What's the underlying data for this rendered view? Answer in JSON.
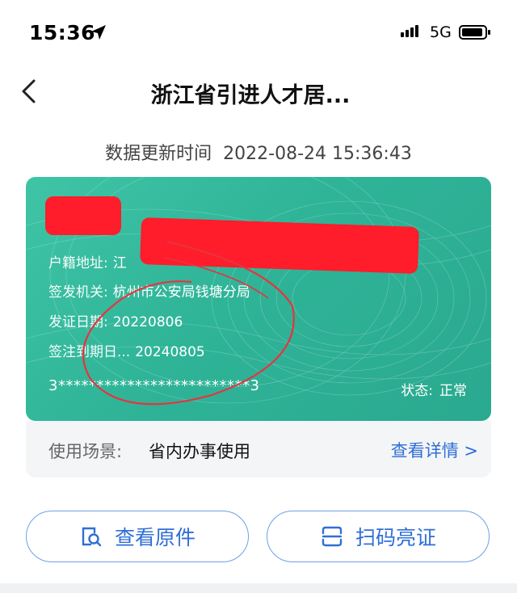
{
  "status_bar": {
    "time": "15:36",
    "network": "5G"
  },
  "nav": {
    "title": "浙江省引进人才居..."
  },
  "update": {
    "label": "数据更新时间",
    "value": "2022-08-24 15:36:43"
  },
  "card": {
    "fields": [
      {
        "label": "户籍地址:",
        "value": "江"
      },
      {
        "label": "签发机关:",
        "value": "杭州市公安局钱塘分局"
      },
      {
        "label": "发证日期:",
        "value": "20220806"
      },
      {
        "label": "签注到期日...",
        "value": "20240805"
      }
    ],
    "number": "3*************************3",
    "status_label": "状态:",
    "status_value": "正常"
  },
  "usage": {
    "label": "使用场景:",
    "value": "省内办事使用",
    "link": "查看详情 >"
  },
  "buttons": {
    "view_original": "查看原件",
    "scan_show": "扫码亮证"
  },
  "colors": {
    "card_green": "#2fb498",
    "accent_blue": "#2f6fd6",
    "redaction": "#ff1d2b"
  },
  "icons": [
    "location-arrow-icon",
    "signal-icon",
    "battery-icon",
    "back-chevron-icon",
    "search-document-icon",
    "scan-code-icon"
  ]
}
